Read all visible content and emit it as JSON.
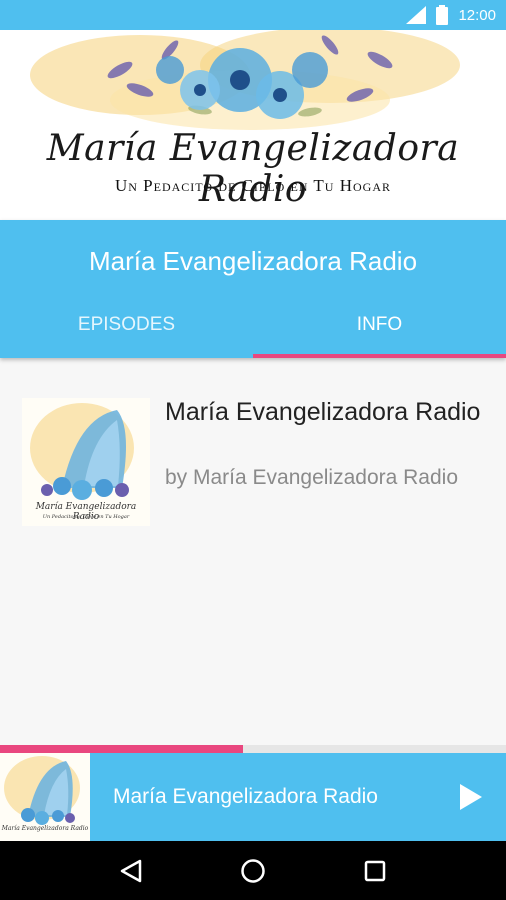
{
  "status_bar": {
    "time": "12:00",
    "icons": [
      "signal-icon",
      "battery-icon"
    ]
  },
  "banner": {
    "title": "María Evangelizadora Radio",
    "subtitle": "Un Pedacito de Cielo en Tu Hogar"
  },
  "appbar": {
    "title": "María Evangelizadora Radio",
    "tabs": [
      {
        "label": "EPISODES",
        "active": false
      },
      {
        "label": "INFO",
        "active": true
      }
    ]
  },
  "podcast": {
    "title": "María Evangelizadora Radio",
    "author": "by María Evangelizadora Radio",
    "cover_caption_title": "María Evangelizadora Radio",
    "cover_caption_subtitle": "Un Pedacito de Cielo en Tu Hogar"
  },
  "player": {
    "progress": 0.48,
    "title": "María Evangelizadora Radio",
    "play_icon": "play-icon"
  },
  "nav": {
    "icons": [
      "back-icon",
      "home-icon",
      "recents-icon"
    ]
  },
  "colors": {
    "primary": "#4fbfef",
    "accent": "#e9477f"
  }
}
